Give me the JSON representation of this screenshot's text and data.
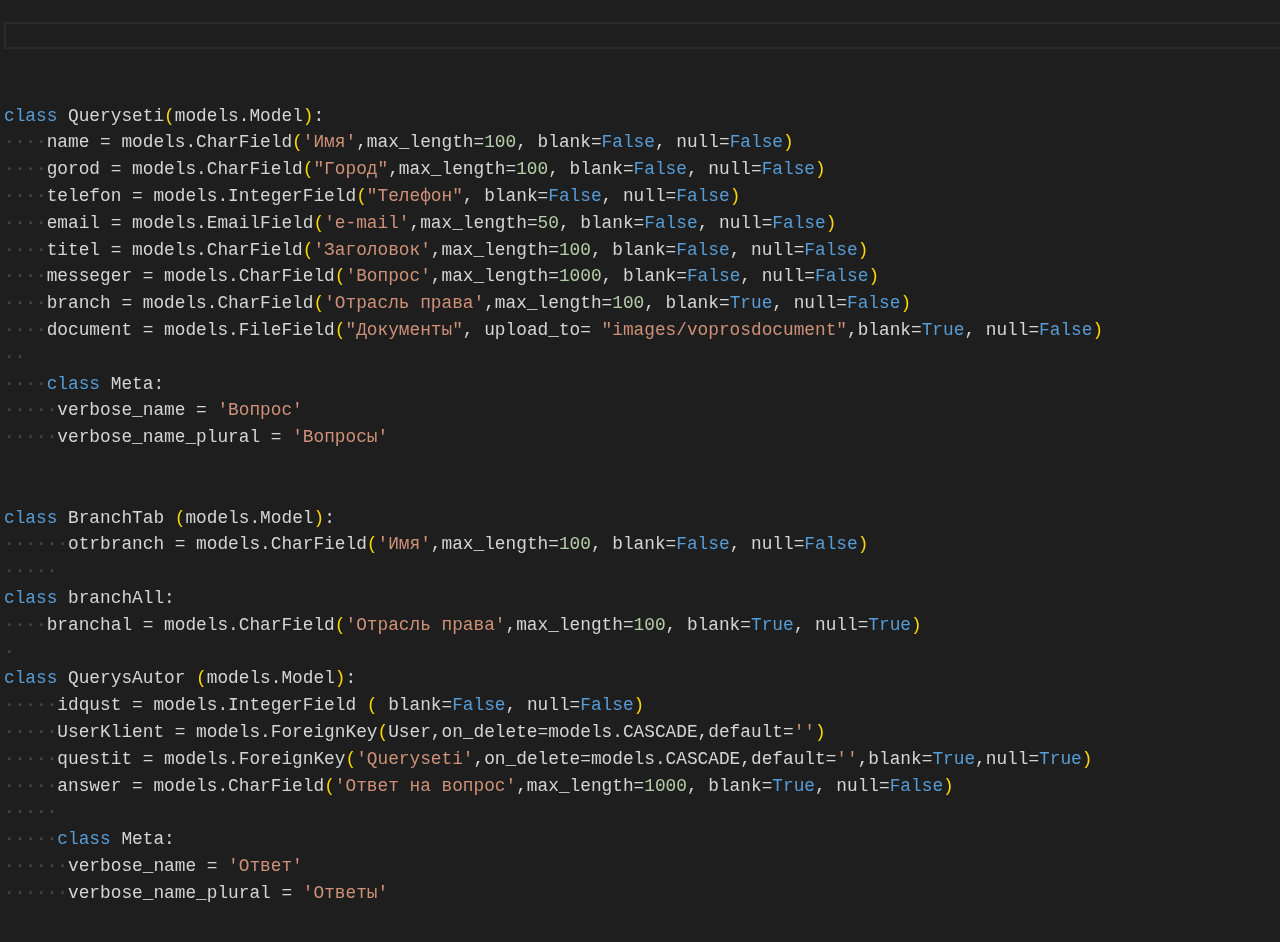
{
  "editor": {
    "lines": [
      {
        "kind": "blank"
      },
      {
        "kind": "blank"
      },
      {
        "kind": "code",
        "tokens": [
          {
            "kind": "keyword",
            "text": "class"
          },
          {
            "kind": "plain",
            "text": " Queryseti"
          },
          {
            "kind": "bracket",
            "text": "("
          },
          {
            "kind": "plain",
            "text": "models.Model"
          },
          {
            "kind": "bracket",
            "text": ")"
          },
          {
            "kind": "plain",
            "text": ":"
          }
        ]
      },
      {
        "kind": "code",
        "tokens": [
          {
            "kind": "whitespace",
            "text": "····"
          },
          {
            "kind": "plain",
            "text": "name = models.CharField"
          },
          {
            "kind": "bracket",
            "text": "("
          },
          {
            "kind": "string",
            "text": "'Имя'"
          },
          {
            "kind": "plain",
            "text": ",max_length="
          },
          {
            "kind": "number",
            "text": "100"
          },
          {
            "kind": "plain",
            "text": ", blank="
          },
          {
            "kind": "constant",
            "text": "False"
          },
          {
            "kind": "plain",
            "text": ", null="
          },
          {
            "kind": "constant",
            "text": "False"
          },
          {
            "kind": "bracket",
            "text": ")"
          }
        ]
      },
      {
        "kind": "code",
        "tokens": [
          {
            "kind": "whitespace",
            "text": "····"
          },
          {
            "kind": "plain",
            "text": "gorod = models.CharField"
          },
          {
            "kind": "bracket",
            "text": "("
          },
          {
            "kind": "string",
            "text": "\"Город\""
          },
          {
            "kind": "plain",
            "text": ",max_length="
          },
          {
            "kind": "number",
            "text": "100"
          },
          {
            "kind": "plain",
            "text": ", blank="
          },
          {
            "kind": "constant",
            "text": "False"
          },
          {
            "kind": "plain",
            "text": ", null="
          },
          {
            "kind": "constant",
            "text": "False"
          },
          {
            "kind": "bracket",
            "text": ")"
          }
        ]
      },
      {
        "kind": "code",
        "tokens": [
          {
            "kind": "whitespace",
            "text": "····"
          },
          {
            "kind": "plain",
            "text": "telefon = models.IntegerField"
          },
          {
            "kind": "bracket",
            "text": "("
          },
          {
            "kind": "string",
            "text": "\"Телефон\""
          },
          {
            "kind": "plain",
            "text": ", blank="
          },
          {
            "kind": "constant",
            "text": "False"
          },
          {
            "kind": "plain",
            "text": ", null="
          },
          {
            "kind": "constant",
            "text": "False"
          },
          {
            "kind": "bracket",
            "text": ")"
          }
        ]
      },
      {
        "kind": "code",
        "tokens": [
          {
            "kind": "whitespace",
            "text": "····"
          },
          {
            "kind": "plain",
            "text": "email = models.EmailField"
          },
          {
            "kind": "bracket",
            "text": "("
          },
          {
            "kind": "string",
            "text": "'e-mail'"
          },
          {
            "kind": "plain",
            "text": ",max_length="
          },
          {
            "kind": "number",
            "text": "50"
          },
          {
            "kind": "plain",
            "text": ", blank="
          },
          {
            "kind": "constant",
            "text": "False"
          },
          {
            "kind": "plain",
            "text": ", null="
          },
          {
            "kind": "constant",
            "text": "False"
          },
          {
            "kind": "bracket",
            "text": ")"
          }
        ]
      },
      {
        "kind": "code",
        "tokens": [
          {
            "kind": "whitespace",
            "text": "····"
          },
          {
            "kind": "plain",
            "text": "titel = models.CharField"
          },
          {
            "kind": "bracket",
            "text": "("
          },
          {
            "kind": "string",
            "text": "'Заголовок'"
          },
          {
            "kind": "plain",
            "text": ",max_length="
          },
          {
            "kind": "number",
            "text": "100"
          },
          {
            "kind": "plain",
            "text": ", blank="
          },
          {
            "kind": "constant",
            "text": "False"
          },
          {
            "kind": "plain",
            "text": ", null="
          },
          {
            "kind": "constant",
            "text": "False"
          },
          {
            "kind": "bracket",
            "text": ")"
          }
        ]
      },
      {
        "kind": "code",
        "tokens": [
          {
            "kind": "whitespace",
            "text": "····"
          },
          {
            "kind": "plain",
            "text": "messeger = models.CharField"
          },
          {
            "kind": "bracket",
            "text": "("
          },
          {
            "kind": "string",
            "text": "'Вопрос'"
          },
          {
            "kind": "plain",
            "text": ",max_length="
          },
          {
            "kind": "number",
            "text": "1000"
          },
          {
            "kind": "plain",
            "text": ", blank="
          },
          {
            "kind": "constant",
            "text": "False"
          },
          {
            "kind": "plain",
            "text": ", null="
          },
          {
            "kind": "constant",
            "text": "False"
          },
          {
            "kind": "bracket",
            "text": ")"
          }
        ]
      },
      {
        "kind": "code",
        "tokens": [
          {
            "kind": "whitespace",
            "text": "····"
          },
          {
            "kind": "plain",
            "text": "branch = models.CharField"
          },
          {
            "kind": "bracket",
            "text": "("
          },
          {
            "kind": "string",
            "text": "'Отрасль права'"
          },
          {
            "kind": "plain",
            "text": ",max_length="
          },
          {
            "kind": "number",
            "text": "100"
          },
          {
            "kind": "plain",
            "text": ", blank="
          },
          {
            "kind": "constant",
            "text": "True"
          },
          {
            "kind": "plain",
            "text": ", null="
          },
          {
            "kind": "constant",
            "text": "False"
          },
          {
            "kind": "bracket",
            "text": ")"
          }
        ]
      },
      {
        "kind": "code",
        "tokens": [
          {
            "kind": "whitespace",
            "text": "····"
          },
          {
            "kind": "plain",
            "text": "document = models.FileField"
          },
          {
            "kind": "bracket",
            "text": "("
          },
          {
            "kind": "string",
            "text": "\"Документы\""
          },
          {
            "kind": "plain",
            "text": ", upload_to= "
          },
          {
            "kind": "string",
            "text": "\"images/voprosdocument\""
          },
          {
            "kind": "plain",
            "text": ",blank="
          },
          {
            "kind": "constant",
            "text": "True"
          },
          {
            "kind": "plain",
            "text": ", null="
          },
          {
            "kind": "constant",
            "text": "False"
          },
          {
            "kind": "bracket",
            "text": ")"
          }
        ]
      },
      {
        "kind": "code",
        "tokens": [
          {
            "kind": "whitespace",
            "text": "··"
          }
        ]
      },
      {
        "kind": "code",
        "tokens": [
          {
            "kind": "whitespace",
            "text": "····"
          },
          {
            "kind": "keyword",
            "text": "class"
          },
          {
            "kind": "plain",
            "text": " Meta:"
          }
        ]
      },
      {
        "kind": "code",
        "tokens": [
          {
            "kind": "whitespace",
            "text": "·····"
          },
          {
            "kind": "plain",
            "text": "verbose_name = "
          },
          {
            "kind": "string",
            "text": "'Вопрос'"
          }
        ]
      },
      {
        "kind": "code",
        "tokens": [
          {
            "kind": "whitespace",
            "text": "·····"
          },
          {
            "kind": "plain",
            "text": "verbose_name_plural = "
          },
          {
            "kind": "string",
            "text": "'Вопросы'"
          }
        ]
      },
      {
        "kind": "blank"
      },
      {
        "kind": "blank"
      },
      {
        "kind": "code",
        "tokens": [
          {
            "kind": "keyword",
            "text": "class"
          },
          {
            "kind": "plain",
            "text": " BranchTab "
          },
          {
            "kind": "bracket",
            "text": "("
          },
          {
            "kind": "plain",
            "text": "models.Model"
          },
          {
            "kind": "bracket",
            "text": ")"
          },
          {
            "kind": "plain",
            "text": ":"
          }
        ]
      },
      {
        "kind": "code",
        "tokens": [
          {
            "kind": "whitespace",
            "text": "······"
          },
          {
            "kind": "plain",
            "text": "otrbranch = models.CharField"
          },
          {
            "kind": "bracket",
            "text": "("
          },
          {
            "kind": "string",
            "text": "'Имя'"
          },
          {
            "kind": "plain",
            "text": ",max_length="
          },
          {
            "kind": "number",
            "text": "100"
          },
          {
            "kind": "plain",
            "text": ", blank="
          },
          {
            "kind": "constant",
            "text": "False"
          },
          {
            "kind": "plain",
            "text": ", null="
          },
          {
            "kind": "constant",
            "text": "False"
          },
          {
            "kind": "bracket",
            "text": ")"
          }
        ]
      },
      {
        "kind": "code",
        "tokens": [
          {
            "kind": "whitespace",
            "text": "·····"
          }
        ]
      },
      {
        "kind": "code",
        "tokens": [
          {
            "kind": "keyword",
            "text": "class"
          },
          {
            "kind": "plain",
            "text": " branchAll:"
          }
        ]
      },
      {
        "kind": "code",
        "tokens": [
          {
            "kind": "whitespace",
            "text": "····"
          },
          {
            "kind": "plain",
            "text": "branchal = models.CharField"
          },
          {
            "kind": "bracket",
            "text": "("
          },
          {
            "kind": "string",
            "text": "'Отрасль права'"
          },
          {
            "kind": "plain",
            "text": ",max_length="
          },
          {
            "kind": "number",
            "text": "100"
          },
          {
            "kind": "plain",
            "text": ", blank="
          },
          {
            "kind": "constant",
            "text": "True"
          },
          {
            "kind": "plain",
            "text": ", null="
          },
          {
            "kind": "constant",
            "text": "True"
          },
          {
            "kind": "bracket",
            "text": ")"
          }
        ]
      },
      {
        "kind": "code",
        "tokens": [
          {
            "kind": "whitespace",
            "text": "·"
          }
        ]
      },
      {
        "kind": "code",
        "tokens": [
          {
            "kind": "keyword",
            "text": "class"
          },
          {
            "kind": "plain",
            "text": " QuerysAutor "
          },
          {
            "kind": "bracket",
            "text": "("
          },
          {
            "kind": "plain",
            "text": "models.Model"
          },
          {
            "kind": "bracket",
            "text": ")"
          },
          {
            "kind": "plain",
            "text": ":"
          }
        ]
      },
      {
        "kind": "code",
        "tokens": [
          {
            "kind": "whitespace",
            "text": "·····"
          },
          {
            "kind": "plain",
            "text": "idqust = models.IntegerField "
          },
          {
            "kind": "bracket",
            "text": "("
          },
          {
            "kind": "plain",
            "text": " blank="
          },
          {
            "kind": "constant",
            "text": "False"
          },
          {
            "kind": "plain",
            "text": ", null="
          },
          {
            "kind": "constant",
            "text": "False"
          },
          {
            "kind": "bracket",
            "text": ")"
          }
        ]
      },
      {
        "kind": "code",
        "tokens": [
          {
            "kind": "whitespace",
            "text": "·····"
          },
          {
            "kind": "plain",
            "text": "UserKlient = models.ForeignKey"
          },
          {
            "kind": "bracket",
            "text": "("
          },
          {
            "kind": "plain",
            "text": "User,on_delete=models.CASCADE,default="
          },
          {
            "kind": "string",
            "text": "''"
          },
          {
            "kind": "bracket",
            "text": ")"
          }
        ]
      },
      {
        "kind": "code",
        "tokens": [
          {
            "kind": "whitespace",
            "text": "·····"
          },
          {
            "kind": "plain",
            "text": "questit = models.ForeignKey"
          },
          {
            "kind": "bracket",
            "text": "("
          },
          {
            "kind": "string",
            "text": "'Queryseti'"
          },
          {
            "kind": "plain",
            "text": ",on_delete=models.CASCADE,default="
          },
          {
            "kind": "string",
            "text": "''"
          },
          {
            "kind": "plain",
            "text": ",blank="
          },
          {
            "kind": "constant",
            "text": "True"
          },
          {
            "kind": "plain",
            "text": ",null="
          },
          {
            "kind": "constant",
            "text": "True"
          },
          {
            "kind": "bracket",
            "text": ")"
          }
        ]
      },
      {
        "kind": "code",
        "tokens": [
          {
            "kind": "whitespace",
            "text": "·····"
          },
          {
            "kind": "plain",
            "text": "answer = models.CharField"
          },
          {
            "kind": "bracket",
            "text": "("
          },
          {
            "kind": "string",
            "text": "'Ответ на вопрос'"
          },
          {
            "kind": "plain",
            "text": ",max_length="
          },
          {
            "kind": "number",
            "text": "1000"
          },
          {
            "kind": "plain",
            "text": ", blank="
          },
          {
            "kind": "constant",
            "text": "True"
          },
          {
            "kind": "plain",
            "text": ", null="
          },
          {
            "kind": "constant",
            "text": "False"
          },
          {
            "kind": "bracket",
            "text": ")"
          }
        ]
      },
      {
        "kind": "code",
        "tokens": [
          {
            "kind": "whitespace",
            "text": "·····"
          }
        ]
      },
      {
        "kind": "code",
        "tokens": [
          {
            "kind": "whitespace",
            "text": "·····"
          },
          {
            "kind": "keyword",
            "text": "class"
          },
          {
            "kind": "plain",
            "text": " Meta:"
          }
        ]
      },
      {
        "kind": "code",
        "tokens": [
          {
            "kind": "whitespace",
            "text": "······"
          },
          {
            "kind": "plain",
            "text": "verbose_name = "
          },
          {
            "kind": "string",
            "text": "'Ответ'"
          }
        ]
      },
      {
        "kind": "code",
        "tokens": [
          {
            "kind": "whitespace",
            "text": "······"
          },
          {
            "kind": "plain",
            "text": "verbose_name_plural = "
          },
          {
            "kind": "string",
            "text": "'Ответы'"
          }
        ]
      }
    ]
  }
}
